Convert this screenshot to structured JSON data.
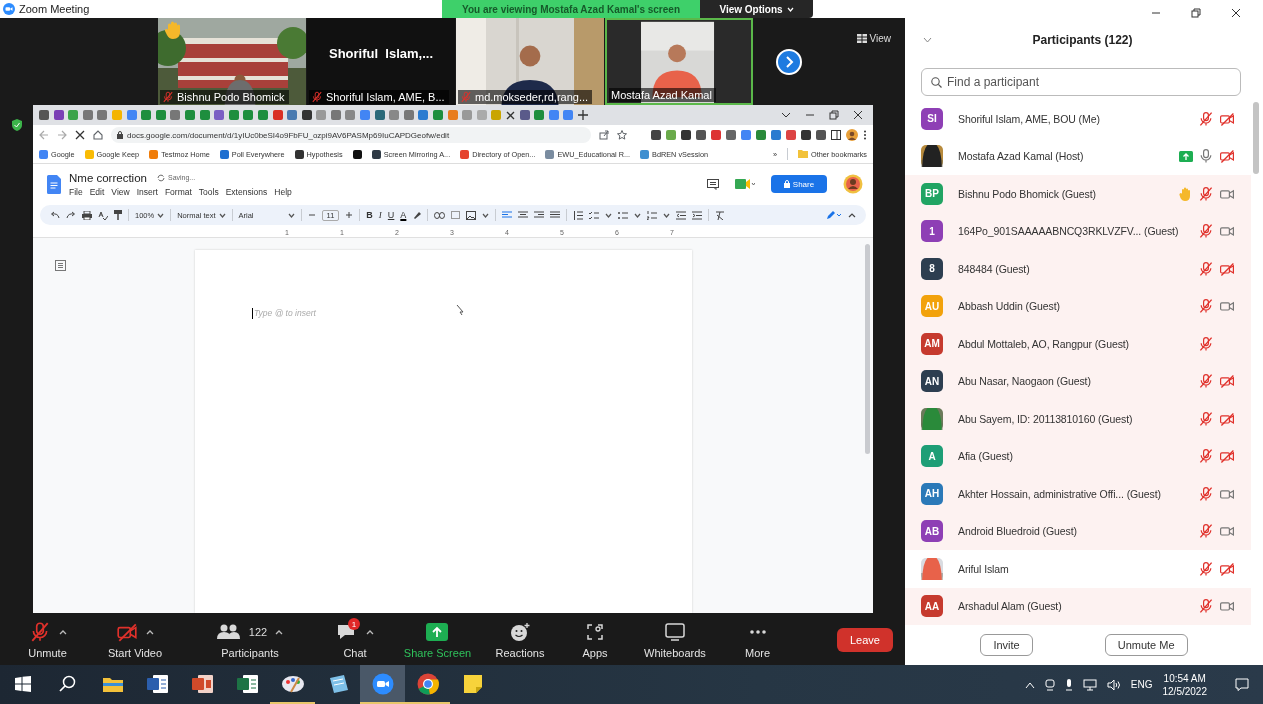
{
  "window": {
    "title": "Zoom Meeting"
  },
  "banner": {
    "text": "You are viewing Mostafa Azad Kamal's screen",
    "view_options": "View Options"
  },
  "video_strip": {
    "view_label": "View",
    "tiles": [
      {
        "name": "Bishnu Podo Bhomick",
        "kind": "building",
        "muted": true,
        "hand": true,
        "active": false
      },
      {
        "name": "Shoriful Islam, AME, B...",
        "kind": "text",
        "center_text": "Shoriful  Islam,...",
        "muted": true,
        "hand": false,
        "active": false
      },
      {
        "name": "md.mokseder,rd,rang...",
        "kind": "office",
        "muted": true,
        "hand": false,
        "active": false
      },
      {
        "name": "Mostafa Azad Kamal",
        "kind": "portrait",
        "muted": false,
        "hand": false,
        "active": true
      }
    ]
  },
  "browser": {
    "url": "docs.google.com/document/d/1yIUc0beSI4o9FbFU_ozpi9AV6PASMp69IuCAPDGeofw/edit",
    "bookmarks": [
      {
        "label": "Google",
        "color": "#4285f4"
      },
      {
        "label": "Google Keep",
        "color": "#f9bb04"
      },
      {
        "label": "Testmoz Home",
        "color": "#f07d0a"
      },
      {
        "label": "Poll Everywhere",
        "color": "#1f6fd0"
      },
      {
        "label": "Hypothesis",
        "color": "#333333"
      },
      {
        "color": "#111111"
      },
      {
        "label": "Screen Mirroring A...",
        "color": "#2f3a45"
      },
      {
        "label": "Directory of Open...",
        "color": "#e5432e"
      },
      {
        "label": "EWU_Educational R...",
        "color": "#7a8ca0"
      },
      {
        "label": "BdREN vSession",
        "color": "#3f8fd0"
      }
    ],
    "more": "»",
    "other_bookmarks": "Other bookmarks"
  },
  "doc": {
    "title": "Nme correction",
    "status": "Saving...",
    "share": "Share",
    "menu": [
      "File",
      "Edit",
      "View",
      "Insert",
      "Format",
      "Tools",
      "Extensions",
      "Help"
    ],
    "zoom": "100%",
    "style": "Normal text",
    "font": "Arial",
    "size": "11",
    "format_buttons": [
      "B",
      "I",
      "U",
      "A"
    ],
    "ruler": [
      "1",
      "1",
      "2",
      "3",
      "4",
      "5",
      "6",
      "7"
    ],
    "placeholder": "Type @ to insert"
  },
  "toolbar": {
    "items": [
      {
        "kind": "mic-muted",
        "label": "Unmute",
        "caret": true
      },
      {
        "kind": "video-off",
        "label": "Start Video",
        "caret": true
      },
      {
        "kind": "participants",
        "label": "Participants",
        "count": "122",
        "caret": true
      },
      {
        "kind": "chat",
        "label": "Chat",
        "badge": "1",
        "caret": true
      },
      {
        "kind": "share",
        "label": "Share Screen",
        "caret": false
      },
      {
        "kind": "reactions",
        "label": "Reactions",
        "caret": false
      },
      {
        "kind": "apps",
        "label": "Apps",
        "caret": false
      },
      {
        "kind": "whiteboard",
        "label": "Whiteboards",
        "caret": false
      },
      {
        "kind": "more",
        "label": "More",
        "caret": false
      }
    ],
    "leave": "Leave"
  },
  "participants": {
    "title": "Participants (122)",
    "search_placeholder": "Find a participant",
    "rows": [
      {
        "name": "Shoriful Islam, AME, BOU (Me)",
        "avatar": {
          "kind": "initials",
          "initials": "SI",
          "color": "#8e3fb5"
        },
        "hand": false,
        "sharing": false,
        "mic_muted": true,
        "video_muted": true,
        "tinted": false
      },
      {
        "name": "Mostafa Azad Kamal (Host)",
        "hand": false,
        "sharing": true,
        "mic_muted": false,
        "video_muted": true,
        "tinted": false
      },
      {
        "name": "Bishnu Podo Bhomick (Guest)",
        "avatar": {
          "kind": "initials",
          "initials": "BP",
          "color": "#21a463"
        },
        "hand": true,
        "sharing": false,
        "mic_muted": true,
        "video_muted": false,
        "tinted": true
      },
      {
        "name": "164Po_901SAAAAABNCQ3RKLVZFV... (Guest)",
        "avatar": {
          "kind": "initials",
          "initials": "1",
          "color": "#8e3fb5"
        },
        "hand": false,
        "sharing": false,
        "mic_muted": true,
        "video_muted": false,
        "tinted": true
      },
      {
        "name": "848484 (Guest)",
        "avatar": {
          "kind": "initials",
          "initials": "8",
          "color": "#2d3e50"
        },
        "hand": false,
        "sharing": false,
        "mic_muted": true,
        "video_muted": true,
        "tinted": true
      },
      {
        "name": "Abbash Uddin (Guest)",
        "avatar": {
          "kind": "initials",
          "initials": "AU",
          "color": "#f2a20c"
        },
        "hand": false,
        "sharing": false,
        "mic_muted": true,
        "video_muted": false,
        "tinted": true
      },
      {
        "name": "Abdul Mottaleb, AO, Rangpur (Guest)",
        "avatar": {
          "kind": "initials",
          "initials": "AM",
          "color": "#c63a2e"
        },
        "hand": false,
        "sharing": false,
        "mic_muted": true,
        "tinted": true
      },
      {
        "name": "Abu Nasar, Naogaon (Guest)",
        "avatar": {
          "kind": "initials",
          "initials": "AN",
          "color": "#2d3e50"
        },
        "hand": false,
        "sharing": false,
        "mic_muted": true,
        "video_muted": true,
        "tinted": true
      },
      {
        "name": "Abu Sayem, ID: 20113810160 (Guest)",
        "hand": false,
        "sharing": false,
        "mic_muted": true,
        "video_muted": true,
        "tinted": true
      },
      {
        "name": "Afia (Guest)",
        "avatar": {
          "kind": "initials",
          "initials": "A",
          "color": "#1e9e76"
        },
        "hand": false,
        "sharing": false,
        "mic_muted": true,
        "video_muted": true,
        "tinted": true
      },
      {
        "name": "Akhter Hossain, administrative Offi... (Guest)",
        "avatar": {
          "kind": "initials",
          "initials": "AH",
          "color": "#2b79b8"
        },
        "hand": false,
        "sharing": false,
        "mic_muted": true,
        "video_muted": false,
        "tinted": true
      },
      {
        "name": "Android Bluedroid (Guest)",
        "avatar": {
          "kind": "initials",
          "initials": "AB",
          "color": "#8e3fb5"
        },
        "hand": false,
        "sharing": false,
        "mic_muted": true,
        "video_muted": false,
        "tinted": true
      },
      {
        "name": "Ariful Islam",
        "hand": false,
        "sharing": false,
        "mic_muted": true,
        "video_muted": true,
        "tinted": false
      },
      {
        "name": "Arshadul Alam (Guest)",
        "avatar": {
          "kind": "initials",
          "initials": "AA",
          "color": "#c63a2e"
        },
        "hand": false,
        "sharing": false,
        "mic_muted": true,
        "video_muted": false,
        "tinted": true
      }
    ],
    "buttons": [
      "Invite",
      "Unmute Me"
    ]
  },
  "taskbar": {
    "apps": [
      {
        "kind": "start",
        "running": false,
        "selected": false
      },
      {
        "kind": "search",
        "running": false,
        "selected": false
      },
      {
        "kind": "explorer",
        "running": false,
        "selected": false
      },
      {
        "kind": "word",
        "running": false,
        "selected": false
      },
      {
        "kind": "powerpoint",
        "running": false,
        "selected": false
      },
      {
        "kind": "excel",
        "running": false,
        "selected": false
      },
      {
        "kind": "paint",
        "running": true,
        "selected": false
      },
      {
        "kind": "notes",
        "running": false,
        "selected": false
      },
      {
        "kind": "zoom",
        "running": true,
        "selected": true
      },
      {
        "kind": "chrome",
        "running": true,
        "selected": false
      },
      {
        "kind": "sticky",
        "running": false,
        "selected": false
      }
    ],
    "language": "ENG",
    "time": "10:54 AM",
    "date": "12/5/2022"
  }
}
